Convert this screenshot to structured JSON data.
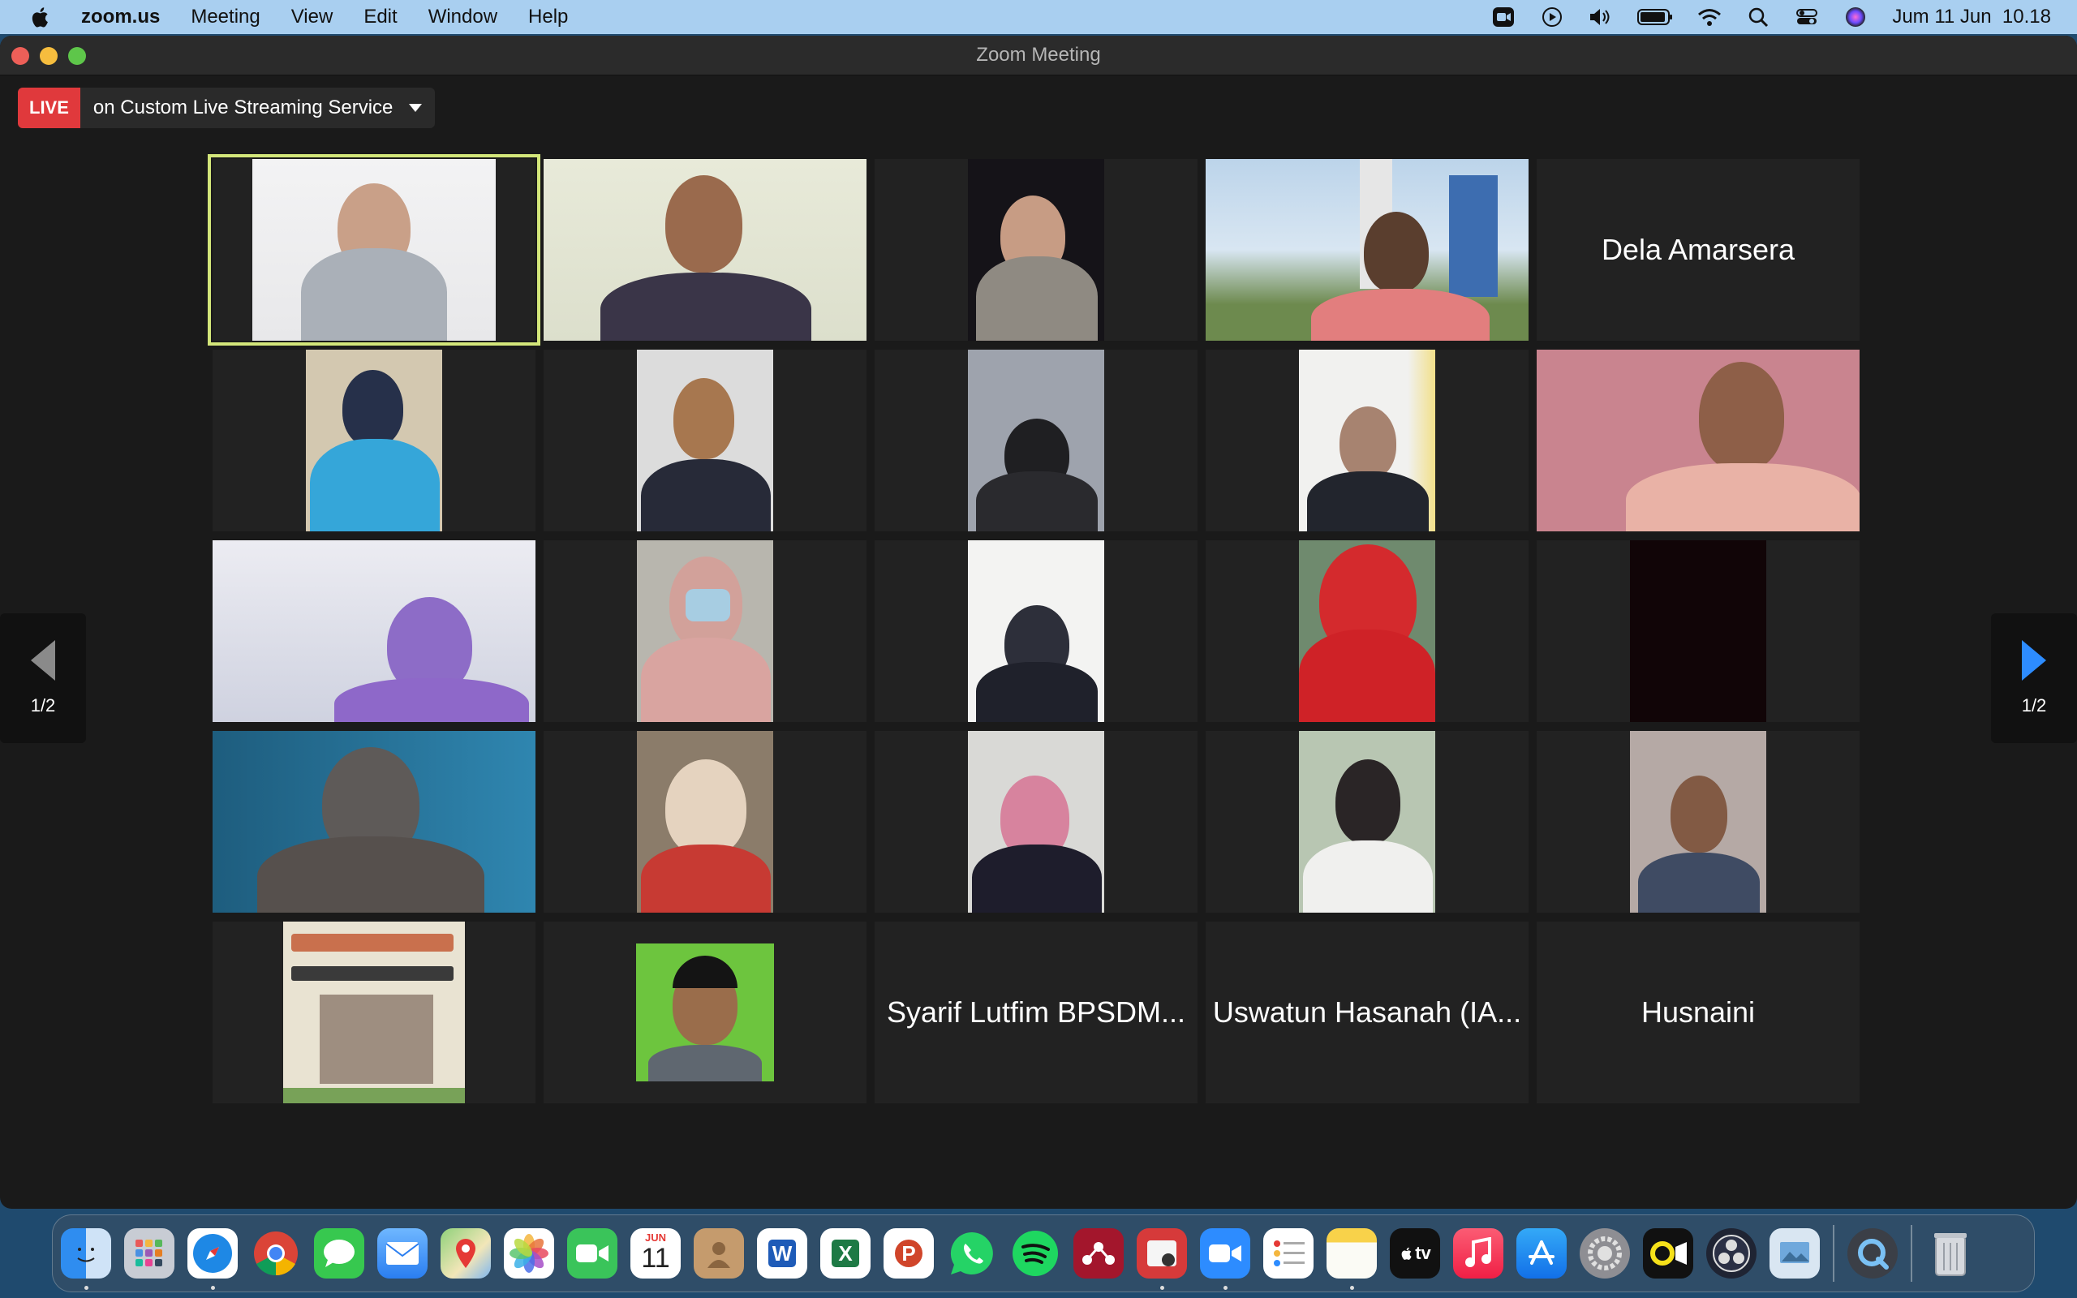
{
  "menubar": {
    "app": "zoom.us",
    "items": [
      "Meeting",
      "View",
      "Edit",
      "Window",
      "Help"
    ],
    "clock": "Jum 11 Jun  10.18",
    "icons": [
      "zoom-video-icon",
      "play-icon",
      "volume-icon",
      "battery-icon",
      "wifi-icon",
      "spotlight-search-icon",
      "control-center-icon",
      "siri-icon"
    ]
  },
  "window": {
    "title": "Zoom Meeting"
  },
  "live": {
    "badge": "LIVE",
    "text": "on Custom Live Streaming Service"
  },
  "gallery": {
    "page_indicator": "1/2",
    "name_tiles": {
      "dela": "Dela Amarsera",
      "syarif": "Syarif Lutfim BPSDM...",
      "uswatun": "Uswatun Hasanah (IA...",
      "husnaini": "Husnaini"
    }
  },
  "dock": {
    "calendar_month": "JUN",
    "calendar_day": "11",
    "word_letter": "W",
    "excel_letter": "X",
    "powerpoint_letter": "P",
    "tv_label": "tv"
  },
  "colors": {
    "active_speaker": "#d3e67a",
    "live_red": "#e0393c",
    "nav_arrow": "#2d8cff"
  }
}
